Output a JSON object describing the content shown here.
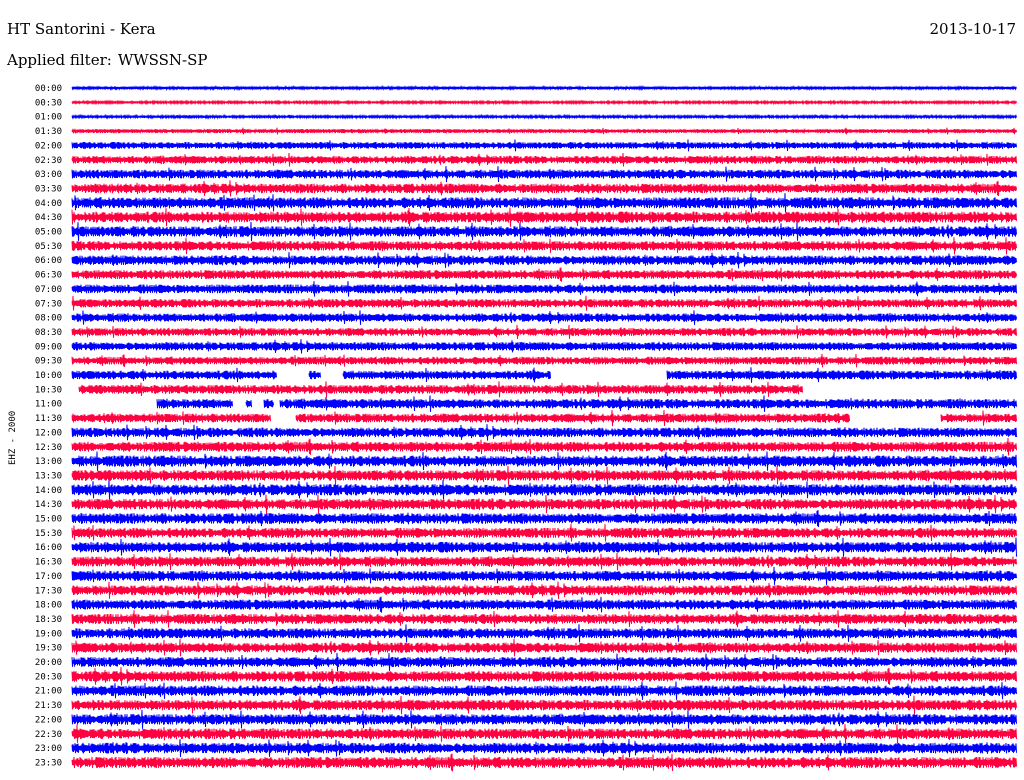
{
  "header": {
    "title": "HT Santorini - Kera",
    "date": "2013-10-17",
    "filter_label": "Applied filter:",
    "filter_value": "WWSSN-SP"
  },
  "channel_label": "EHZ - 2000",
  "colors": {
    "even_trace": "#0000ff",
    "odd_trace": "#ff0040",
    "background": "#ffffff"
  },
  "chart_data": {
    "type": "line",
    "title": "HT Santorini - Kera",
    "ylabel": "EHZ - 2000",
    "xlabel": "",
    "grid": false,
    "legend": "none",
    "categories": [
      "00:00",
      "00:30",
      "01:00",
      "01:30",
      "02:00",
      "02:30",
      "03:00",
      "03:30",
      "04:00",
      "04:30",
      "05:00",
      "05:30",
      "06:00",
      "06:30",
      "07:00",
      "07:30",
      "08:00",
      "08:30",
      "09:00",
      "09:30",
      "10:00",
      "10:30",
      "11:00",
      "11:30",
      "12:00",
      "12:30",
      "13:00",
      "13:30",
      "14:00",
      "14:30",
      "15:00",
      "15:30",
      "16:00",
      "16:30",
      "17:00",
      "17:30",
      "18:00",
      "18:30",
      "19:00",
      "19:30",
      "20:00",
      "20:30",
      "21:00",
      "21:30",
      "22:00",
      "22:30",
      "23:00",
      "23:30"
    ],
    "series": [
      {
        "values": [
          0.25,
          0.18,
          0.2,
          0.35,
          0.6,
          0.7,
          0.8,
          0.85,
          1.0,
          1.0,
          0.95,
          0.85,
          0.85,
          0.8,
          0.8,
          0.75,
          0.75,
          0.7,
          0.75,
          0.7,
          0.8,
          0.8,
          0.85,
          0.8,
          0.85,
          0.9,
          1.0,
          0.95,
          1.0,
          0.95,
          0.95,
          0.9,
          0.95,
          0.9,
          0.9,
          0.9,
          0.9,
          0.9,
          0.9,
          0.9,
          0.9,
          0.95,
          0.95,
          0.95,
          0.95,
          0.95,
          0.95,
          1.0
        ]
      }
    ],
    "amplitude_unit": "relative",
    "gaps": [
      {
        "row": "10:00",
        "start_min": 6.5,
        "end_min": 7.5
      },
      {
        "row": "10:00",
        "start_min": 7.9,
        "end_min": 8.6
      },
      {
        "row": "10:00",
        "start_min": 15.2,
        "end_min": 18.9
      },
      {
        "row": "10:30",
        "start_min": 0,
        "end_min": 0.2
      },
      {
        "row": "10:30",
        "start_min": 23.2,
        "end_min": 30
      },
      {
        "row": "11:00",
        "start_min": 0,
        "end_min": 2.7
      },
      {
        "row": "11:00",
        "start_min": 5.1,
        "end_min": 5.5
      },
      {
        "row": "11:00",
        "start_min": 5.7,
        "end_min": 6.1
      },
      {
        "row": "11:00",
        "start_min": 6.4,
        "end_min": 6.6
      },
      {
        "row": "11:30",
        "start_min": 6.3,
        "end_min": 7.1
      },
      {
        "row": "11:30",
        "start_min": 24.7,
        "end_min": 27.6
      }
    ]
  }
}
